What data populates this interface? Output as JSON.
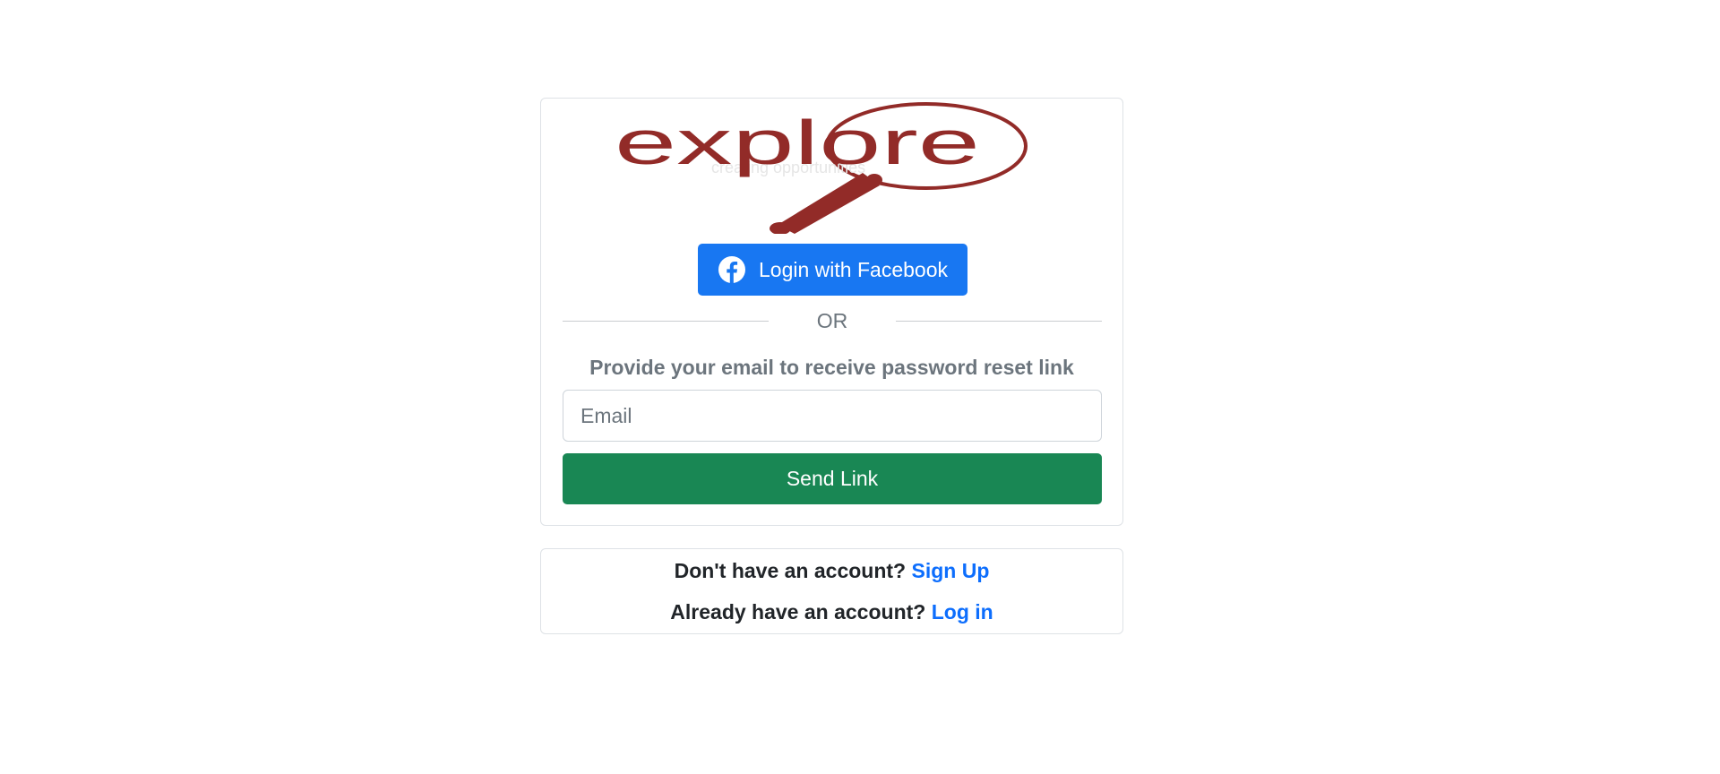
{
  "logo": {
    "wordmark": "explore",
    "brand_color": "#922b28"
  },
  "facebook": {
    "label": "Login with Facebook",
    "icon": "facebook-icon",
    "color": "#1877f2"
  },
  "divider": {
    "text": "OR"
  },
  "reset": {
    "hint": "Provide your email to receive password reset link",
    "email_placeholder": "Email",
    "email_value": "",
    "submit_label": "Send Link",
    "submit_color": "#198754"
  },
  "footer": {
    "signup_prompt": "Don't have an account?",
    "signup_link": "Sign Up",
    "login_prompt": "Already have an account?",
    "login_link": "Log in",
    "link_color": "#0d6efd"
  }
}
